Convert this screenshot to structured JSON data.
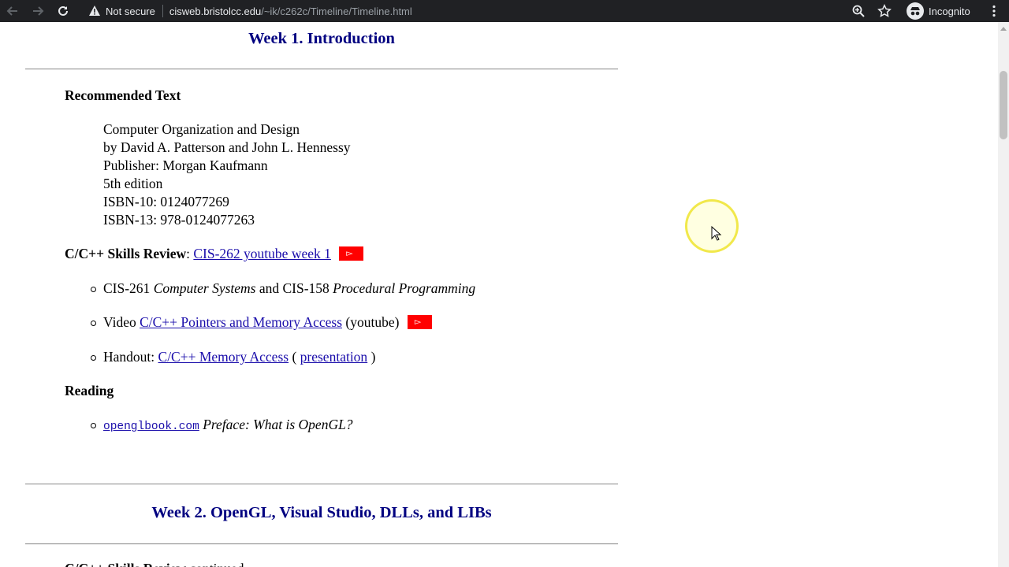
{
  "browser": {
    "security_label": "Not secure",
    "url_host": "cisweb.bristolcc.edu",
    "url_path": "/~ik/c262c/Timeline/Timeline.html",
    "profile_label": "Incognito"
  },
  "week1": {
    "title": "Week 1. Introduction",
    "recommended_text": {
      "heading": "Recommended Text",
      "lines": [
        "Computer Organization and Design",
        "by David A. Patterson and John L. Hennessy",
        "Publisher: Morgan Kaufmann",
        "5th edition",
        "ISBN-10: 0124077269",
        "ISBN-13: 978-0124077263"
      ]
    },
    "skills_review": {
      "label": "C/C++ Skills Review",
      "colon": ":",
      "link": "CIS-262 youtube week 1",
      "yt_glyph": "▻"
    },
    "bullets": {
      "b1_a": "CIS-261 ",
      "b1_em1": "Computer Systems",
      "b1_b": " and CIS-158 ",
      "b1_em2": "Procedural Programming",
      "b2_a": "Video ",
      "b2_link": "C/C++ Pointers and Memory Access",
      "b2_b": " (youtube)",
      "b3_a": "Handout: ",
      "b3_link1": "C/C++ Memory Access",
      "b3_b": " ( ",
      "b3_link2": "presentation",
      "b3_c": " )"
    },
    "reading": {
      "heading": "Reading",
      "link": "openglbook.com",
      "text": " Preface: What is OpenGL?"
    }
  },
  "week2": {
    "title": "Week 2. OpenGL, Visual Studio, DLLs, and LIBs",
    "partial_heading": "C/C++ Skills Review",
    "partial_rest": " continued"
  },
  "colors": {
    "week_title": "#000080",
    "link": "#1a0dab",
    "youtube": "#ff0000",
    "chrome_bg": "#202124"
  }
}
